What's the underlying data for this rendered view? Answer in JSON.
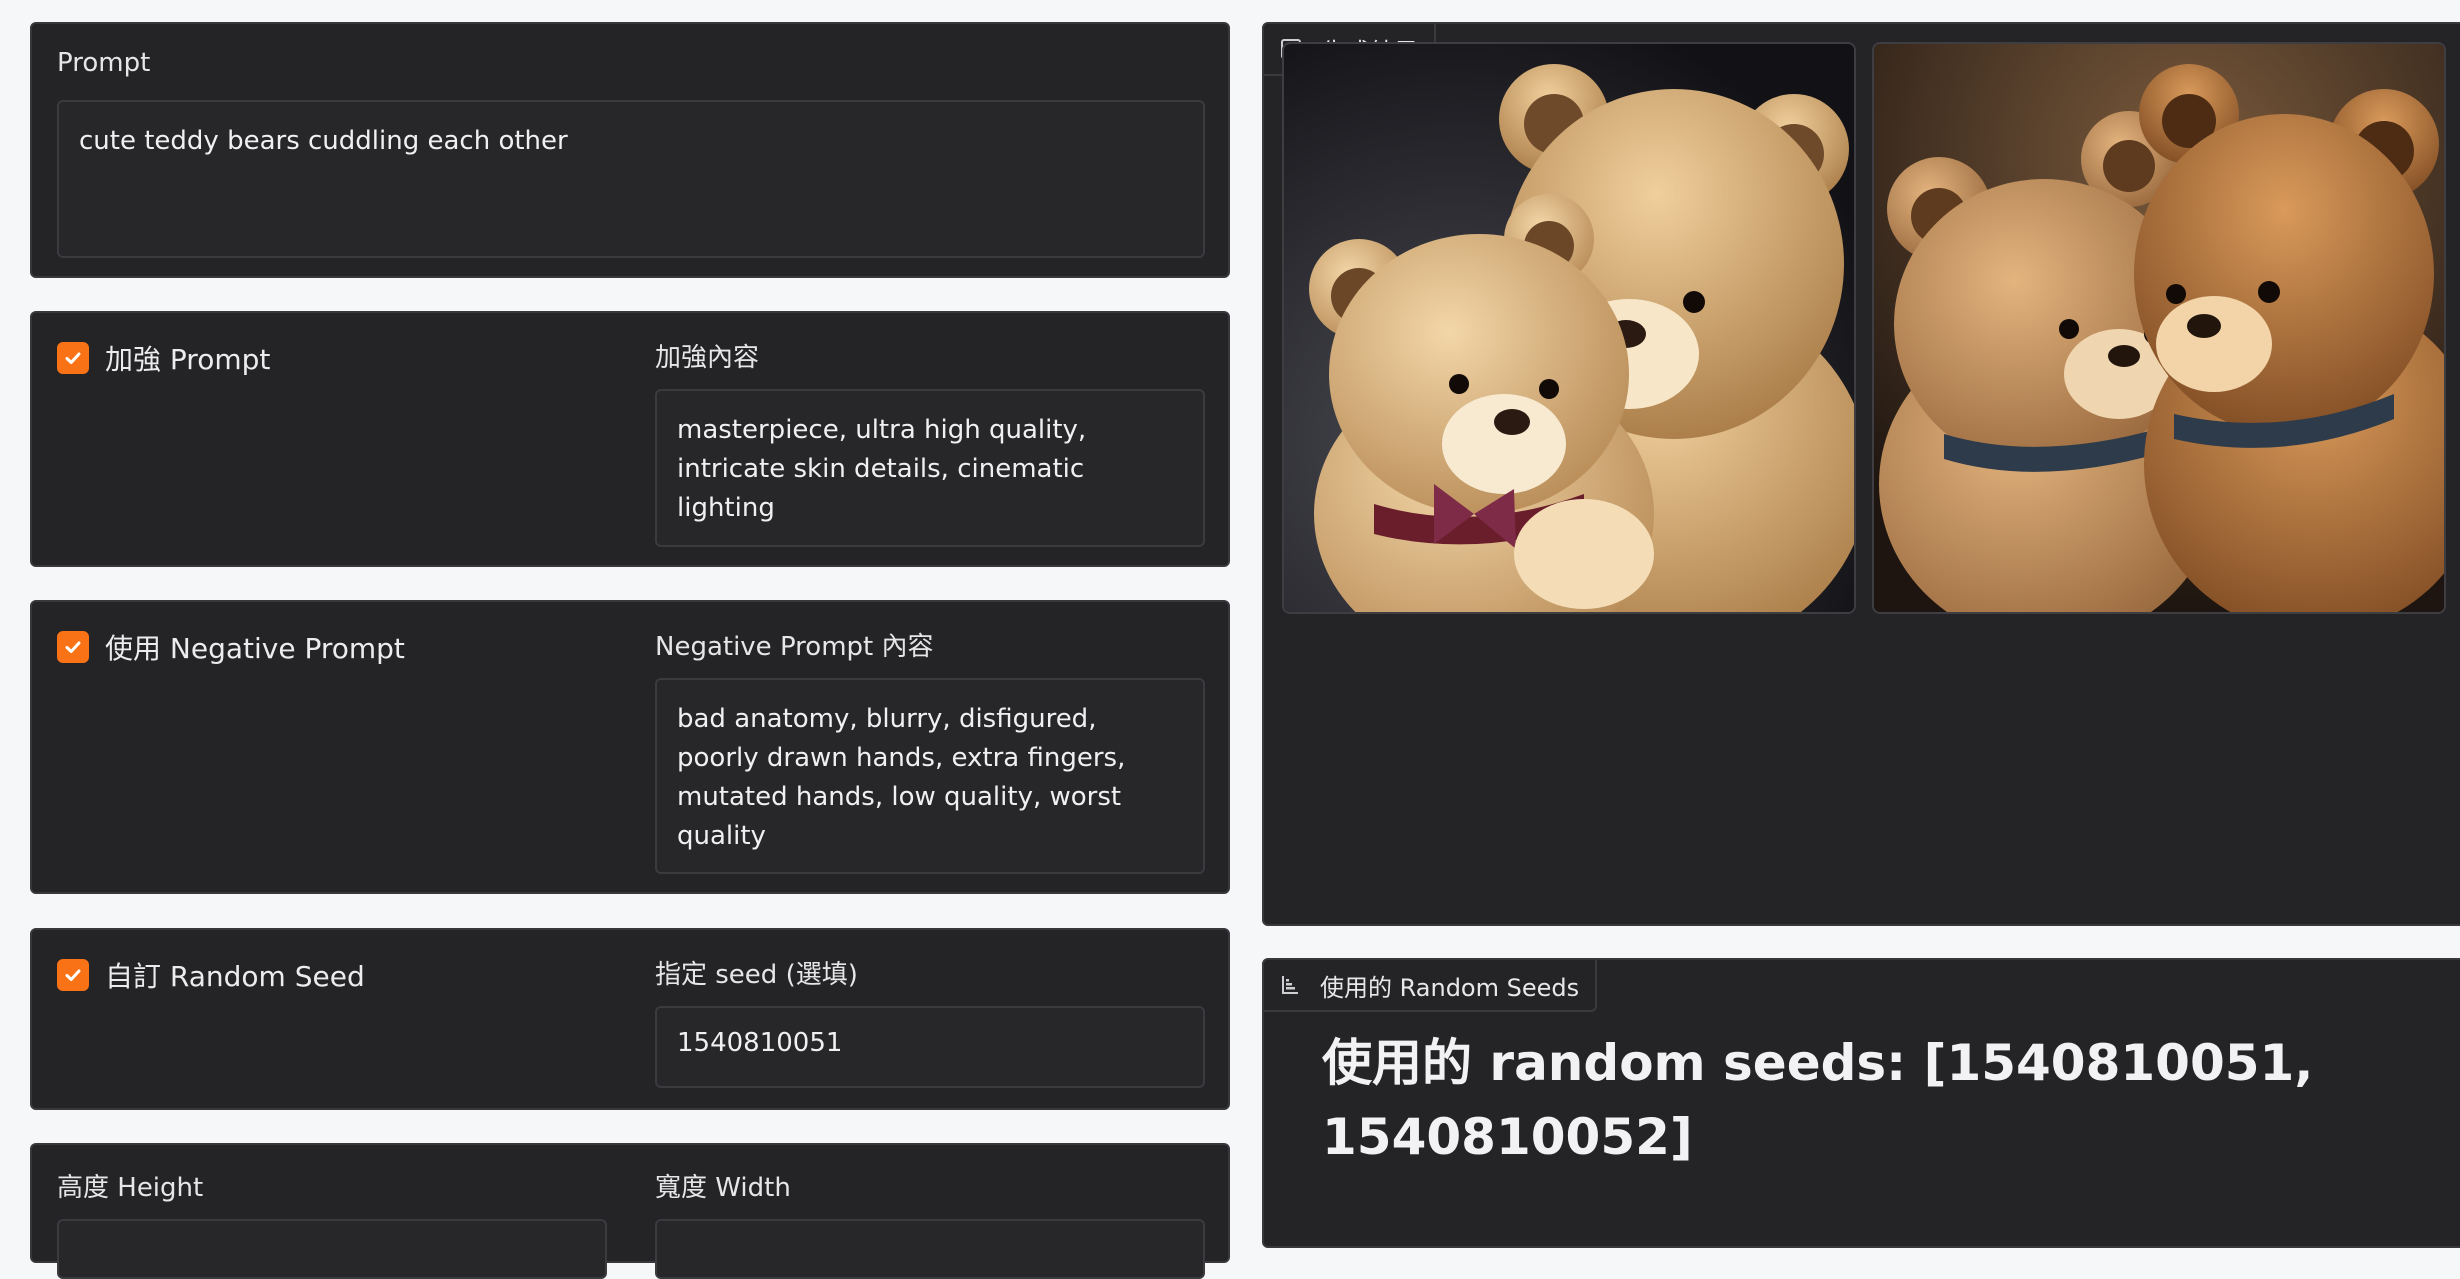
{
  "prompt_panel": {
    "label": "Prompt",
    "value": "cute teddy bears cuddling each other"
  },
  "enhance_panel": {
    "checkbox_label": "加強 Prompt",
    "checked": true,
    "content_label": "加強內容",
    "content_value": "masterpiece, ultra high quality, intricate skin details, cinematic lighting"
  },
  "negative_panel": {
    "checkbox_label": "使用 Negative Prompt",
    "checked": true,
    "content_label": "Negative Prompt 內容",
    "content_value": "bad anatomy, blurry, disfigured, poorly drawn hands, extra fingers, mutated hands, low quality, worst quality"
  },
  "seed_panel": {
    "checkbox_label": "自訂 Random Seed",
    "checked": true,
    "seed_label": "指定 seed (選填)",
    "seed_value": "1540810051"
  },
  "size_panel": {
    "height_label": "高度 Height",
    "width_label": "寬度 Width"
  },
  "gallery": {
    "label": "生成結果",
    "icon": "image-icon",
    "images": [
      "teddy-bears-image-1",
      "teddy-bears-image-2"
    ]
  },
  "seeds_output": {
    "label": "使用的 Random Seeds",
    "icon": "chart-icon",
    "text": "使用的 random seeds: [1540810051, 1540810052]"
  },
  "colors": {
    "accent": "#f97316",
    "panel": "#242427",
    "page": "#f6f7f8"
  }
}
